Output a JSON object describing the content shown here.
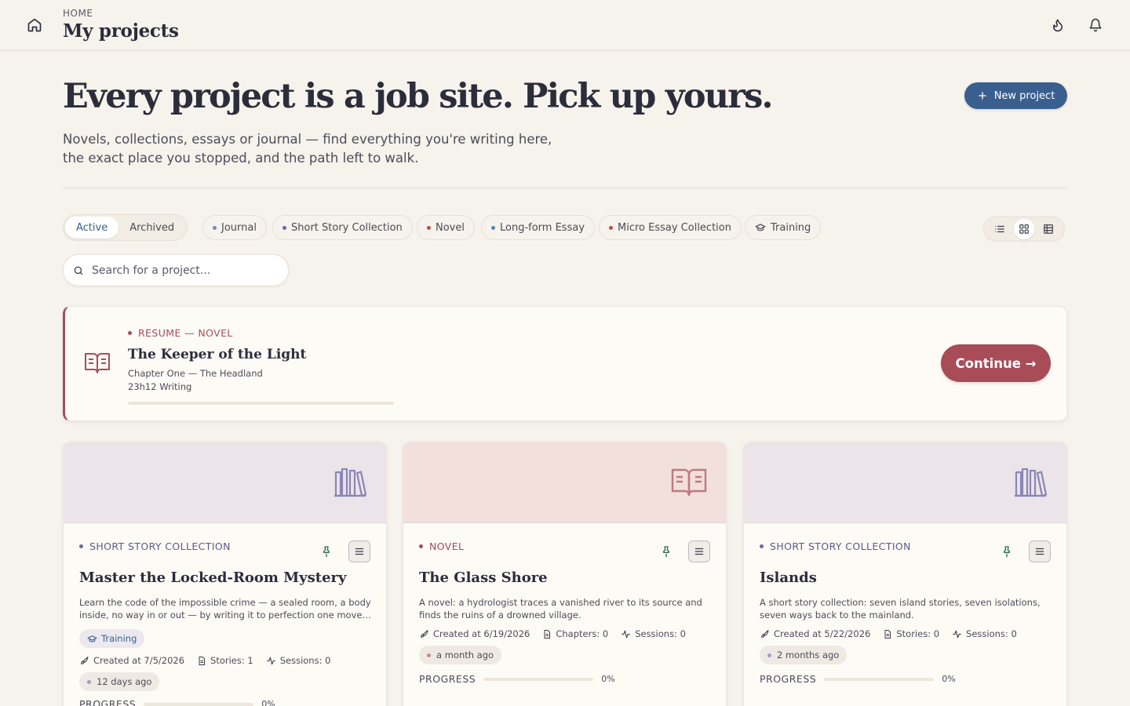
{
  "header": {
    "breadcrumb": "HOME",
    "title": "My projects",
    "icons": [
      "home-icon",
      "flame-icon",
      "bell-icon"
    ]
  },
  "hero": {
    "title": "Every project is a job site. Pick up yours.",
    "subtitle_line1": "Novels, collections, essays or journal — find everything you're writing here,",
    "subtitle_line2": "the exact place you stopped, and the path left to walk.",
    "new_button": "New project"
  },
  "filters": {
    "status": [
      {
        "label": "Active",
        "selected": true
      },
      {
        "label": "Archived",
        "selected": false
      }
    ],
    "types": [
      {
        "label": "Journal",
        "color": "#7a86b0"
      },
      {
        "label": "Short Story Collection",
        "color": "#6c6a9c"
      },
      {
        "label": "Novel",
        "color": "#b3553f"
      },
      {
        "label": "Long-form Essay",
        "color": "#4f8aa8"
      },
      {
        "label": "Micro Essay Collection",
        "color": "#b3553f"
      },
      {
        "label": "Training",
        "icon": "graduation-cap-icon"
      }
    ],
    "views": [
      "list-view-icon",
      "grid-view-icon",
      "table-view-icon"
    ],
    "active_view": "grid"
  },
  "search": {
    "placeholder": "Search for a project...",
    "value": ""
  },
  "resume": {
    "label": "RESUME — NOVEL",
    "title": "The Keeper of the Light",
    "chapter": "Chapter One — The Headland",
    "time": "23h12 Writing",
    "progress": 0,
    "button": "Continue →",
    "accent": "#a84c58"
  },
  "projects": [
    {
      "type": "SHORT STORY COLLECTION",
      "title": "Master the Locked-Room Mystery",
      "description": "Learn the code of the impossible crime — a sealed room, a body inside, no way in or out — by writing it to perfection one move at a time.",
      "tag": "Training",
      "created": "Created at 7/5/2026",
      "count": "Stories: 1",
      "sessions": "Sessions: 0",
      "ago": "12 days ago",
      "progress_label": "PROGRESS",
      "progress_pct": "0%",
      "progress": 0,
      "cover_color": "#ebe4e8",
      "icon_color": "#8a86b8"
    },
    {
      "type": "NOVEL",
      "title": "The Glass Shore",
      "description": "A novel: a hydrologist traces a vanished river to its source and finds the ruins of a drowned village.",
      "created": "Created at 6/19/2026",
      "count": "Chapters: 0",
      "sessions": "Sessions: 0",
      "ago": "a month ago",
      "progress_label": "PROGRESS",
      "progress_pct": "0%",
      "progress": 0,
      "cover_color": "#f1e0dc",
      "icon_color": "#c07880"
    },
    {
      "type": "SHORT STORY COLLECTION",
      "title": "Islands",
      "description": "A short story collection: seven island stories, seven isolations, seven ways back to the mainland.",
      "created": "Created at 5/22/2026",
      "count": "Stories: 0",
      "sessions": "Sessions: 0",
      "ago": "2 months ago",
      "progress_label": "PROGRESS",
      "progress_pct": "0%",
      "progress": 0,
      "cover_color": "#ebe4e8",
      "icon_color": "#8a86b8"
    }
  ],
  "colors": {
    "background": "#f6f2ec",
    "primary": "#3a5f8e",
    "accent": "#a84c58",
    "card": "#fdfbf6"
  }
}
